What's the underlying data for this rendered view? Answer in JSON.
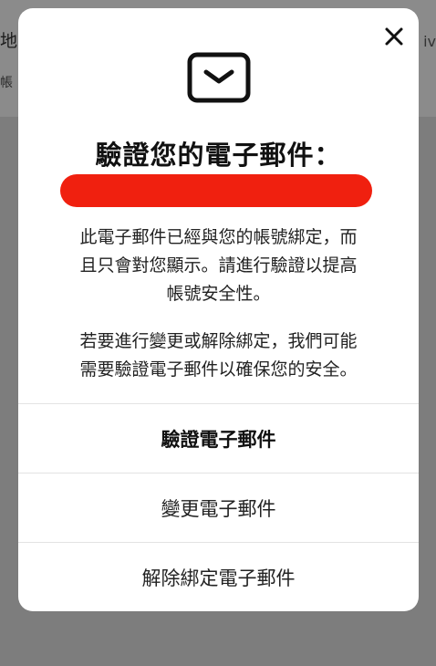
{
  "background": {
    "left_text_1": "地",
    "left_text_2": "帳",
    "right_text": "iv"
  },
  "modal": {
    "close_icon": "close-icon",
    "mail_icon": "mail-icon",
    "title": "驗證您的電子郵件：",
    "description_1": "此電子郵件已經與您的帳號綁定，而\n且只會對您顯示。請進行驗證以提高\n帳號安全性。",
    "description_2": "若要進行變更或解除綁定，我們可能\n需要驗證電子郵件以確保您的安全。",
    "actions": [
      {
        "label": "驗證電子郵件"
      },
      {
        "label": "變更電子郵件"
      },
      {
        "label": "解除綁定電子郵件"
      }
    ]
  },
  "colors": {
    "redaction": "#f0200f",
    "overlay": "#7d7d7d"
  }
}
